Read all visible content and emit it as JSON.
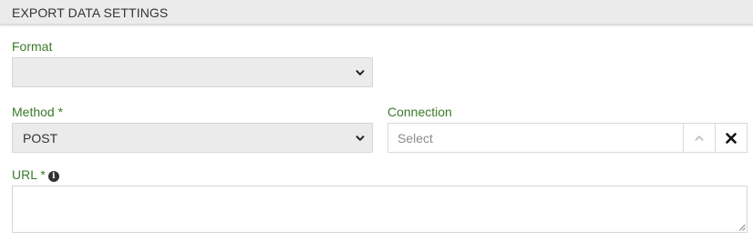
{
  "section": {
    "title": "EXPORT DATA SETTINGS"
  },
  "format": {
    "label": "Format",
    "value": ""
  },
  "method": {
    "label": "Method *",
    "value": "POST"
  },
  "connection": {
    "label": "Connection",
    "placeholder": "Select"
  },
  "url": {
    "label": "URL *",
    "value": ""
  },
  "icons": {
    "select_chevron": "chevron-down-icon",
    "connection_toggle": "chevron-up-icon",
    "connection_clear": "close-icon",
    "url_info": "info-icon"
  },
  "colors": {
    "label_green": "#3b7a2a",
    "header_bg": "#ebebeb",
    "select_bg": "#ebebeb"
  }
}
